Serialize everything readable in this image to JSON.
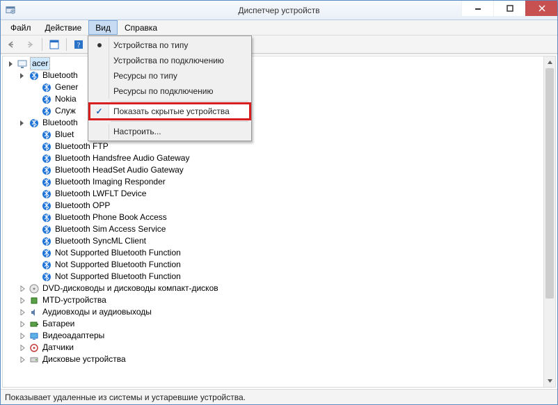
{
  "window": {
    "title": "Диспетчер устройств"
  },
  "menu": {
    "file": "Файл",
    "action": "Действие",
    "view": "Вид",
    "help": "Справка"
  },
  "dropdown": {
    "by_type": "Устройства по типу",
    "by_connection": "Устройства по подключению",
    "res_by_type": "Ресурсы по типу",
    "res_by_connection": "Ресурсы по подключению",
    "show_hidden": "Показать скрытые устройства",
    "customize": "Настроить..."
  },
  "tree": {
    "root": "acer",
    "cat_bt1": "Bluetooth",
    "bt1_items": {
      "0": "Gener",
      "1": "Nokia",
      "2": "Служ"
    },
    "cat_bt2": "Bluetooth",
    "bt2_items": {
      "0": "Bluet",
      "1": "Bluetooth FTP",
      "2": "Bluetooth Handsfree Audio Gateway",
      "3": "Bluetooth HeadSet Audio Gateway",
      "4": "Bluetooth Imaging Responder",
      "5": "Bluetooth LWFLT Device",
      "6": "Bluetooth OPP",
      "7": "Bluetooth Phone Book Access",
      "8": "Bluetooth Sim Access Service",
      "9": "Bluetooth SyncML Client",
      "10": "Not Supported Bluetooth Function",
      "11": "Not Supported Bluetooth Function",
      "12": "Not Supported Bluetooth Function"
    },
    "cat_dvd": "DVD-дисководы и дисководы компакт-дисков",
    "cat_mtd": "MTD-устройства",
    "cat_audio": "Аудиовходы и аудиовыходы",
    "cat_battery": "Батареи",
    "cat_video": "Видеоадаптеры",
    "cat_sensors": "Датчики",
    "cat_disks": "Дисковые устройства"
  },
  "status": {
    "text": "Показывает удаленные из системы и устаревшие устройства."
  }
}
